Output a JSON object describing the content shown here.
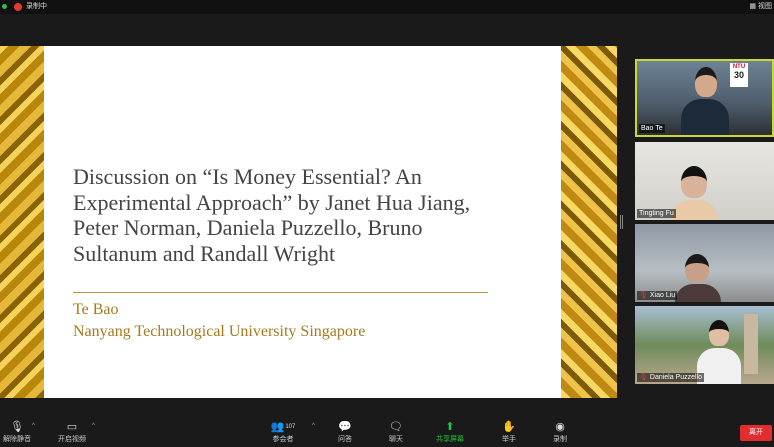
{
  "topbar": {
    "recording_label": "录制中",
    "view_label": "视图"
  },
  "slide": {
    "title": "Discussion on “Is Money Essential? An Experimental Approach” by Janet Hua Jiang, Peter Norman, Daniela Puzzello, Bruno Sultanum and Randall Wright",
    "author": "Te Bao",
    "affiliation": "Nanyang Technological University Singapore"
  },
  "participants": [
    {
      "name": "Bao Te",
      "muted": false
    },
    {
      "name": "Tingting Fu",
      "muted": false
    },
    {
      "name": "Xiao Liu",
      "muted": true
    },
    {
      "name": "Daniela Puzzello",
      "muted": true
    }
  ],
  "ntu_badge": {
    "brand": "NTU",
    "number": "30"
  },
  "toolbar": {
    "unmute": "解除静音",
    "start_video": "开启视频",
    "participants": "参会者",
    "participants_count": "107",
    "qa": "问答",
    "chat": "聊天",
    "share_screen": "共享屏幕",
    "raise_hand": "举手",
    "record": "录制",
    "leave": "离开"
  },
  "colors": {
    "accent_green": "#1ec83a",
    "leave_red": "#e02e2e",
    "active_speaker": "#c9d936"
  }
}
